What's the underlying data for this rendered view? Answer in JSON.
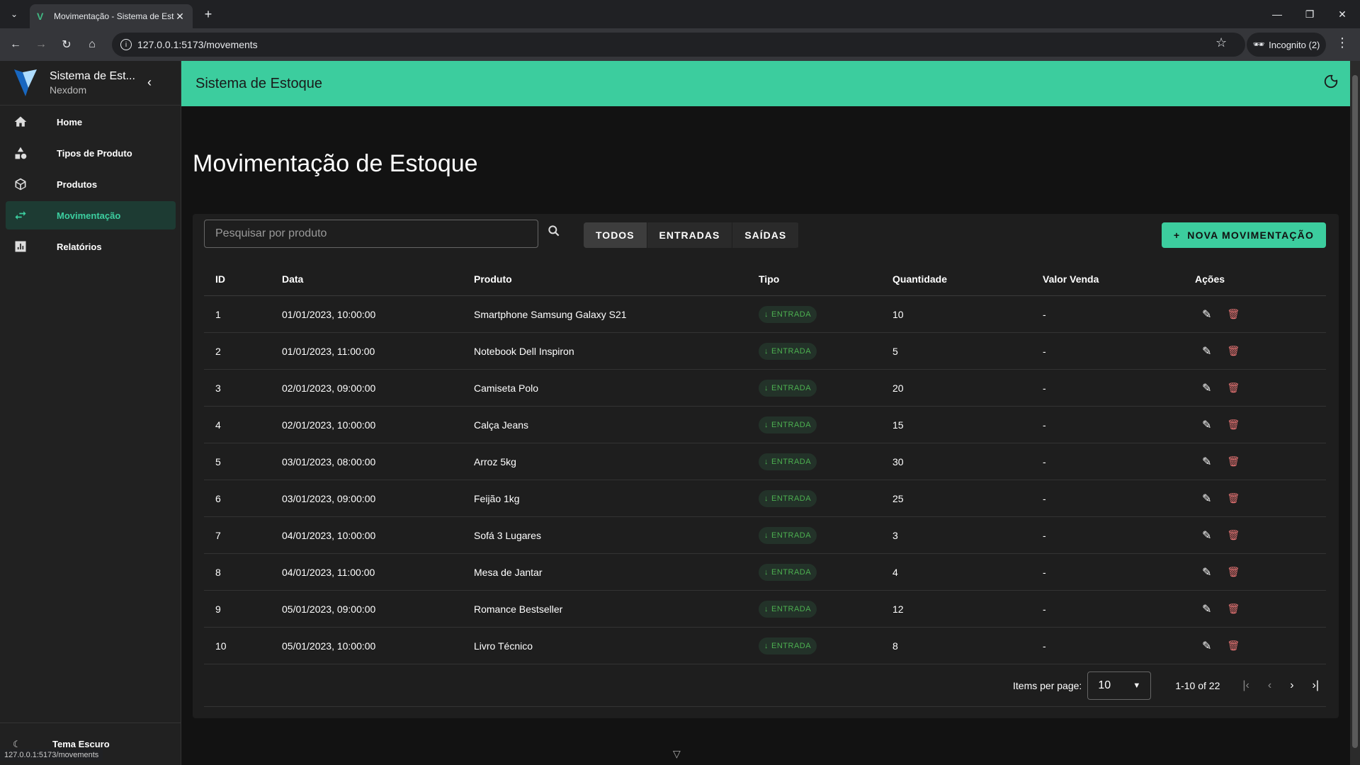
{
  "browser": {
    "tab_title": "Movimentação - Sistema de Est",
    "url": "127.0.0.1:5173/movements",
    "incognito_label": "Incognito (2)",
    "status_url": "127.0.0.1:5173/movements"
  },
  "sidebar": {
    "app_title": "Sistema de Est...",
    "app_subtitle": "Nexdom",
    "items": [
      {
        "label": "Home",
        "icon": "home-icon"
      },
      {
        "label": "Tipos de Produto",
        "icon": "shapes-icon"
      },
      {
        "label": "Produtos",
        "icon": "package-icon"
      },
      {
        "label": "Movimentação",
        "icon": "swap-icon",
        "active": true
      },
      {
        "label": "Relatórios",
        "icon": "chart-icon"
      }
    ],
    "footer_label": "Tema Escuro"
  },
  "topbar": {
    "title": "Sistema de Estoque"
  },
  "page": {
    "title": "Movimentação de Estoque"
  },
  "toolbar": {
    "search_placeholder": "Pesquisar por produto",
    "filters": [
      "TODOS",
      "ENTRADAS",
      "SAÍDAS"
    ],
    "selected_filter": "TODOS",
    "new_button": "NOVA MOVIMENTAÇÃO"
  },
  "table": {
    "headers": [
      "ID",
      "Data",
      "Produto",
      "Tipo",
      "Quantidade",
      "Valor Venda",
      "Ações"
    ],
    "rows": [
      {
        "id": "1",
        "data": "01/01/2023, 10:00:00",
        "produto": "Smartphone Samsung Galaxy S21",
        "tipo": "ENTRADA",
        "qtd": "10",
        "valor": "-"
      },
      {
        "id": "2",
        "data": "01/01/2023, 11:00:00",
        "produto": "Notebook Dell Inspiron",
        "tipo": "ENTRADA",
        "qtd": "5",
        "valor": "-"
      },
      {
        "id": "3",
        "data": "02/01/2023, 09:00:00",
        "produto": "Camiseta Polo",
        "tipo": "ENTRADA",
        "qtd": "20",
        "valor": "-"
      },
      {
        "id": "4",
        "data": "02/01/2023, 10:00:00",
        "produto": "Calça Jeans",
        "tipo": "ENTRADA",
        "qtd": "15",
        "valor": "-"
      },
      {
        "id": "5",
        "data": "03/01/2023, 08:00:00",
        "produto": "Arroz 5kg",
        "tipo": "ENTRADA",
        "qtd": "30",
        "valor": "-"
      },
      {
        "id": "6",
        "data": "03/01/2023, 09:00:00",
        "produto": "Feijão 1kg",
        "tipo": "ENTRADA",
        "qtd": "25",
        "valor": "-"
      },
      {
        "id": "7",
        "data": "04/01/2023, 10:00:00",
        "produto": "Sofá 3 Lugares",
        "tipo": "ENTRADA",
        "qtd": "3",
        "valor": "-"
      },
      {
        "id": "8",
        "data": "04/01/2023, 11:00:00",
        "produto": "Mesa de Jantar",
        "tipo": "ENTRADA",
        "qtd": "4",
        "valor": "-"
      },
      {
        "id": "9",
        "data": "05/01/2023, 09:00:00",
        "produto": "Romance Bestseller",
        "tipo": "ENTRADA",
        "qtd": "12",
        "valor": "-"
      },
      {
        "id": "10",
        "data": "05/01/2023, 10:00:00",
        "produto": "Livro Técnico",
        "tipo": "ENTRADA",
        "qtd": "8",
        "valor": "-"
      }
    ]
  },
  "pagination": {
    "items_per_page_label": "Items per page:",
    "items_per_page": "10",
    "range": "1-10 of 22"
  },
  "colors": {
    "accent": "#3ccd9e",
    "entrada": "#4caf50",
    "delete": "#e57373"
  }
}
